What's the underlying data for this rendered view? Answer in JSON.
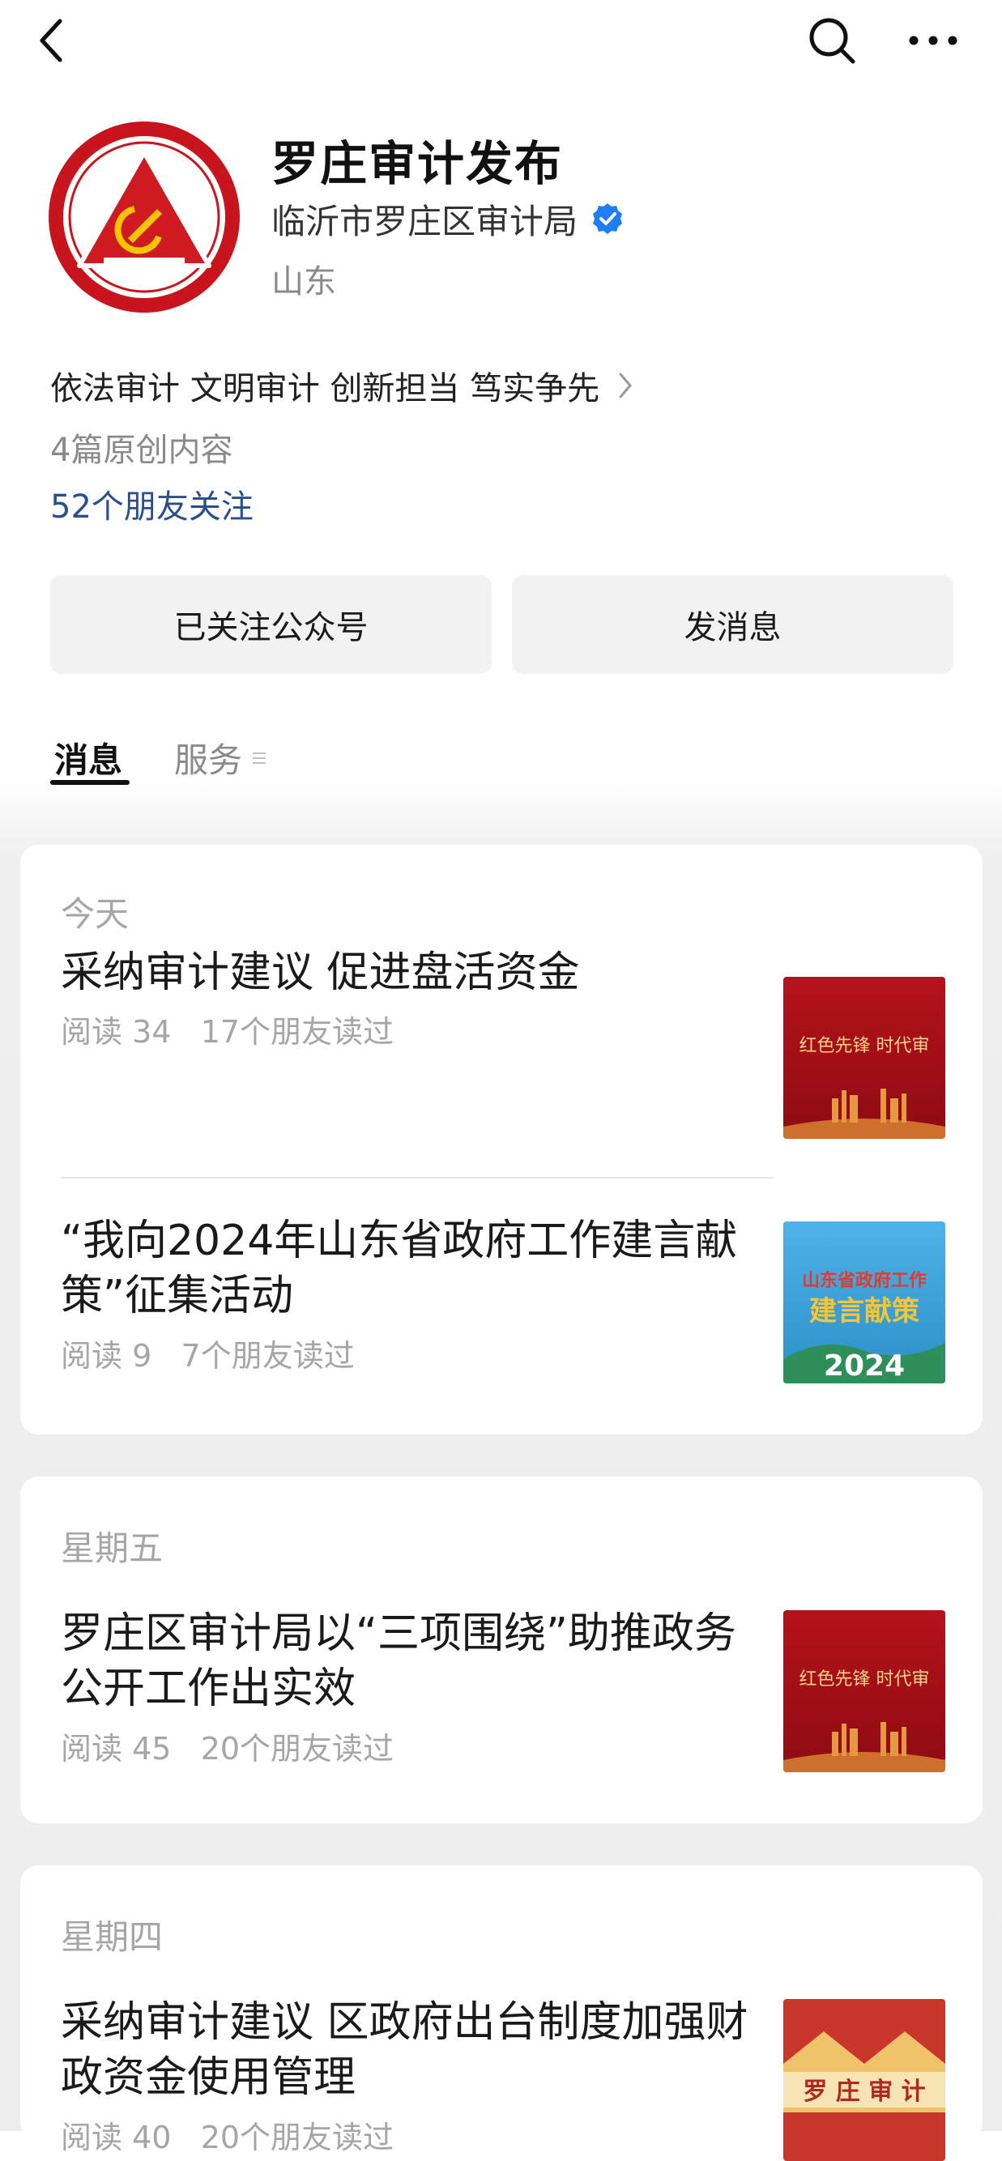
{
  "account": {
    "name": "罗庄审计发布",
    "org": "临沂市罗庄区审计局",
    "region": "山东",
    "intro": "依法审计 文明审计 创新担当 笃实争先",
    "original_count": "4篇原创内容",
    "friends_following": "52个朋友关注"
  },
  "buttons": {
    "follow": "已关注公众号",
    "message": "发消息"
  },
  "tabs": {
    "messages": "消息",
    "services": "服务"
  },
  "groups": [
    {
      "day": "今天",
      "articles": [
        {
          "title": "采纳审计建议 促进盘活资金",
          "reads": "阅读 34",
          "friends": "17个朋友读过",
          "thumb_text": "红色先锋 时代审"
        },
        {
          "title": "“我向2024年山东省政府工作建言献策”征集活动",
          "reads": "阅读 9",
          "friends": "7个朋友读过",
          "thumb_text_1": "山东省政府工作",
          "thumb_text_2": "建言献策",
          "thumb_text_3": "2024"
        }
      ]
    },
    {
      "day": "星期五",
      "articles": [
        {
          "title": "罗庄区审计局以“三项围绕”助推政务公开工作出实效",
          "reads": "阅读 45",
          "friends": "20个朋友读过",
          "thumb_text": "红色先锋 时代审"
        }
      ]
    },
    {
      "day": "星期四",
      "articles": [
        {
          "title": "采纳审计建议 区政府出台制度加强财政资金使用管理",
          "reads": "阅读 40",
          "friends": "20个朋友读过",
          "thumb_text": "罗 庄 审 计"
        }
      ]
    }
  ],
  "colors": {
    "link": "#2a4f8f",
    "verified": "#1f7ef5",
    "brand_red": "#c8151d"
  }
}
